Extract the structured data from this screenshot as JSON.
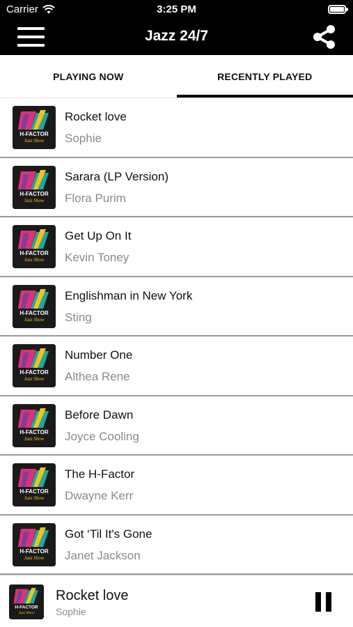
{
  "status_bar": {
    "carrier": "Carrier",
    "time": "3:25 PM"
  },
  "nav": {
    "title": "Jazz 24/7",
    "menu_icon": "hamburger-menu-icon",
    "share_icon": "share-icon"
  },
  "tabs": [
    {
      "label": "PLAYING NOW",
      "active": false
    },
    {
      "label": "RECENTLY PLAYED",
      "active": true
    }
  ],
  "tracks": [
    {
      "title": "Rocket love",
      "artist": "Sophie"
    },
    {
      "title": "Sarara (LP Version)",
      "artist": "Flora Purim"
    },
    {
      "title": "Get Up On It",
      "artist": "Kevin Toney"
    },
    {
      "title": "Englishman in New York",
      "artist": "Sting"
    },
    {
      "title": "Number One",
      "artist": "Althea Rene"
    },
    {
      "title": "Before Dawn",
      "artist": "Joyce Cooling"
    },
    {
      "title": "The H-Factor",
      "artist": "Dwayne Kerr"
    },
    {
      "title": "Got ‘Til It's Gone",
      "artist": "Janet Jackson"
    }
  ],
  "album_art": {
    "line1": "H-FACTOR",
    "line2": "Jazz Show"
  },
  "player": {
    "title": "Rocket love",
    "artist": "Sophie",
    "control_icon": "pause-icon"
  },
  "colors": {
    "header_bg": "#000000",
    "artist_text": "#8a8a8a",
    "art_pink": "#e0307a",
    "art_teal": "#1fa7a0",
    "art_yellow": "#f2c318",
    "art_purple": "#7d3f9a"
  }
}
